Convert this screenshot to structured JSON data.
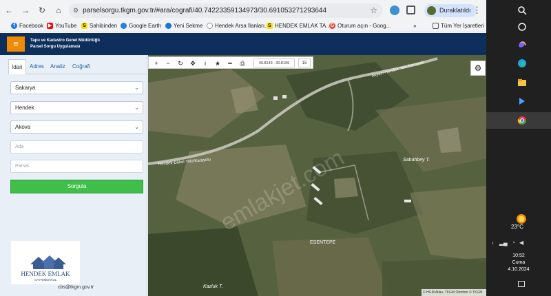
{
  "browser": {
    "url": "parselsorgu.tkgm.gov.tr/#ara/cografi/40.74223359134973/30.691053271293644",
    "profile_name": "Duraklatıldı",
    "bookmarks": [
      "Facebook",
      "YouTube",
      "Sahibinden",
      "Google Earth",
      "Yeni Sekme",
      "Hendek Arsa İlanları...",
      "HENDEK EMLAK TA...",
      "Oturum açın - Goog...",
      "Tüm Yer İşaretleri"
    ],
    "bookmark_more": "»"
  },
  "site": {
    "title_line1": "Tapu ve Kadastro Genel Müdürlüğü",
    "title_line2": "Parsel Sorgu Uygulaması"
  },
  "panel": {
    "tabs": [
      "İdari",
      "Adres",
      "Analiz",
      "Coğrafi"
    ],
    "province": "Sakarya",
    "district": "Hendek",
    "neighborhood": "Akova",
    "ada_placeholder": "Ada",
    "parsel_placeholder": "Parsel",
    "query_button": "Sorgula",
    "logo_text": "HENDEK EMLAK",
    "logo_sub": "GAYRİMENKUL",
    "email": "cbs@tkgm.gov.tr"
  },
  "map": {
    "coordinates": "40.8143 : 30.8199",
    "zoom": "15",
    "labels": {
      "road1": "Akyazı-Hendek Yolu/Karayolu",
      "road2": "Hendek-Dükel Yolu/Karayolu",
      "village1": "Sabahbey T.",
      "village2": "ESENTEPE",
      "village3": "Kazluk T.",
      "watermark": "emlakjet.com"
    },
    "attribution": "© HGM Atlas, TKGM Ortofoto © TKGM"
  },
  "taskbar": {
    "temperature": "23°C",
    "time": "10:52",
    "day": "Cuma",
    "date": "4.10.2024"
  }
}
